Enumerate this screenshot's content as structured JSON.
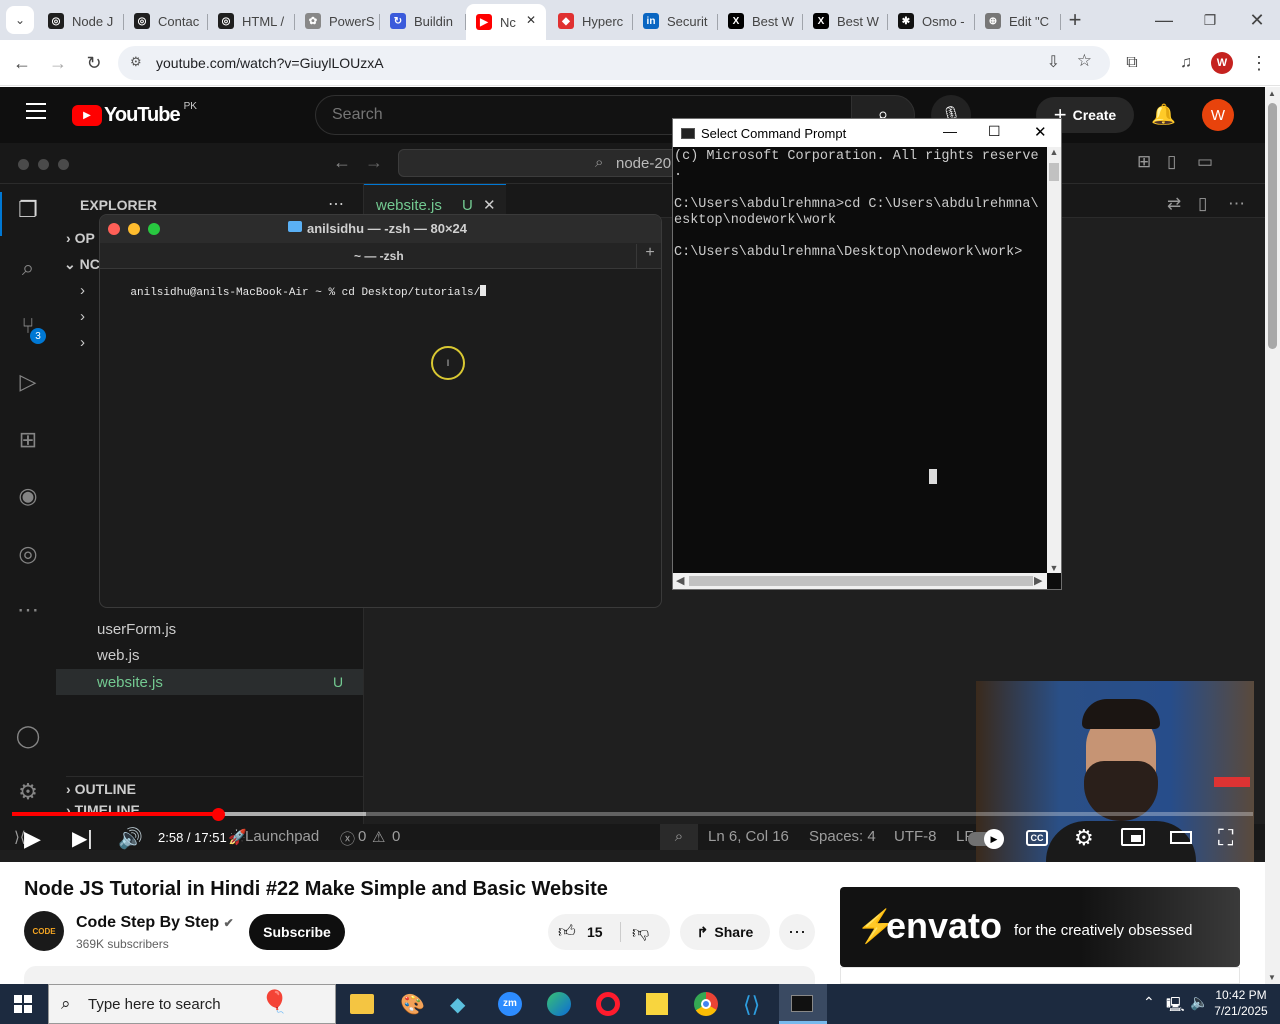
{
  "browser": {
    "tabs": [
      {
        "label": "Node J",
        "fav_color": "#1f1f1f",
        "fav_text": "◎"
      },
      {
        "label": "Contac",
        "fav_color": "#1f1f1f",
        "fav_text": "◎"
      },
      {
        "label": "HTML /",
        "fav_color": "#1f1f1f",
        "fav_text": "◎"
      },
      {
        "label": "PowerS",
        "fav_color": "#888",
        "fav_text": "✿"
      },
      {
        "label": "Buildin",
        "fav_color": "#3b5bdb",
        "fav_text": "↻"
      },
      {
        "label": "Nc",
        "fav_color": "#ff0000",
        "fav_text": "▶"
      },
      {
        "label": "Hyperc",
        "fav_color": "#e03131",
        "fav_text": "◆"
      },
      {
        "label": "Securit",
        "fav_color": "#0a66c2",
        "fav_text": "in"
      },
      {
        "label": "Best W",
        "fav_color": "#000",
        "fav_text": "X"
      },
      {
        "label": "Best W",
        "fav_color": "#000",
        "fav_text": "X"
      },
      {
        "label": "Osmo -",
        "fav_color": "#111",
        "fav_text": "✱"
      },
      {
        "label": "Edit \"C",
        "fav_color": "#777",
        "fav_text": "⊕"
      }
    ],
    "url": "youtube.com/watch?v=GiuylLOUzxA",
    "profile_initial": "W"
  },
  "youtube": {
    "logo": "YouTube",
    "region": "PK",
    "search_placeholder": "Search",
    "create_label": "Create",
    "avatar_initial": "W",
    "video_title": "Node JS Tutorial in Hindi #22 Make Simple and Basic Website",
    "channel_name": "Code Step By Step",
    "subscribers": "369K subscribers",
    "subscribe_label": "Subscribe",
    "likes": "15",
    "share_label": "Share",
    "ad_brand": "envato",
    "ad_tagline": "for the creatively obsessed",
    "time_current": "2:58",
    "time_total": "17:51",
    "progress_fraction": 0.166
  },
  "vscode": {
    "search_text": "node-20",
    "explorer_label": "EXPLORER",
    "section_open": "OP",
    "section_folder": "NC",
    "files": [
      "userForm.js",
      "web.js",
      "website.js"
    ],
    "active_file_badge": "U",
    "editor_tab": "website.js",
    "editor_tab_badge": "U",
    "outline_label": "OUTLINE",
    "timeline_label": "TIMELINE",
    "git_badge": "3",
    "status": {
      "launchpad": "Launchpad",
      "errors": "0",
      "warnings": "0",
      "position": "Ln 6, Col 16",
      "spaces": "Spaces: 4",
      "encoding": "UTF-8",
      "eol": "LF"
    }
  },
  "mac_terminal": {
    "title": "anilsidhu — -zsh — 80×24",
    "tab_title": "~ — -zsh",
    "prompt_line": "anilsidhu@anils-MacBook-Air ~ % cd Desktop/tutorials/"
  },
  "cmd": {
    "title": "Select Command Prompt",
    "lines": [
      "(c) Microsoft Corporation. All rights reserve",
      ".",
      "",
      "C:\\Users\\abdulrehmna>cd C:\\Users\\abdulrehmna\\",
      "esktop\\nodework\\work",
      "",
      "C:\\Users\\abdulrehmna\\Desktop\\nodework\\work>"
    ]
  },
  "taskbar": {
    "search_placeholder": "Type here to search",
    "time": "10:42 PM",
    "date": "7/21/2025"
  }
}
